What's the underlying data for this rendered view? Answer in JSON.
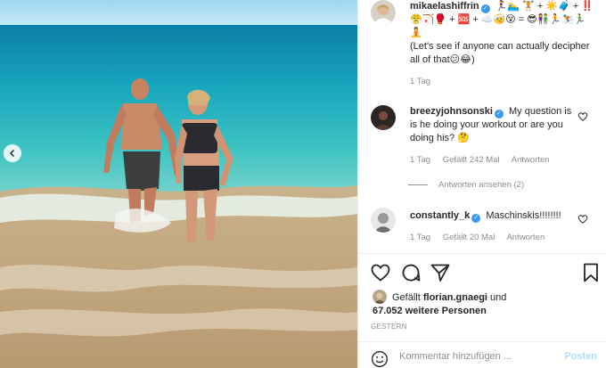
{
  "caption": {
    "username": "mikaelashiffrin",
    "emoji_sequence": "🏃‍♀️🏊‍♂️ 🏋️ + ☀️🧳 + ‼️😤🏹🥊 + 🆘 + ☁️🤕😵 = 😎👫🏃⛷️🏃‍♂️🧘",
    "text": "(Let's see if anyone can actually decipher all of that😕😂)",
    "time": "1 Tag"
  },
  "comments": [
    {
      "username": "breezyjohnsonski",
      "text": "My question is is he doing your workout or are you doing his? 🤔",
      "time": "1 Tag",
      "likes": "Gefällt 242 Mal",
      "reply_label": "Antworten",
      "view_replies": "Antworten ansehen (2)"
    },
    {
      "username": "constantly_k",
      "text": "Maschinskis!!!!!!!!",
      "time": "1 Tag",
      "likes": "Gefällt 20 Mal",
      "reply_label": "Antworten"
    }
  ],
  "likes_block": {
    "prefix": "Gefällt",
    "user": "florian.gnaegi",
    "connector": "und",
    "count": "67.052 weitere Personen"
  },
  "date_label": "GESTERN",
  "add_comment": {
    "placeholder": "Kommentar hinzufügen ...",
    "post_label": "Posten"
  },
  "icons": {
    "verified": "verified-badge-icon",
    "heart": "heart-icon",
    "comment": "comment-icon",
    "share": "share-icon",
    "save": "bookmark-icon",
    "emoji": "smiley-icon",
    "prev": "chevron-left-icon"
  },
  "colors": {
    "link_blue": "#3897f0",
    "muted": "#8e8e8e",
    "post_disabled": "#b3dbff"
  }
}
